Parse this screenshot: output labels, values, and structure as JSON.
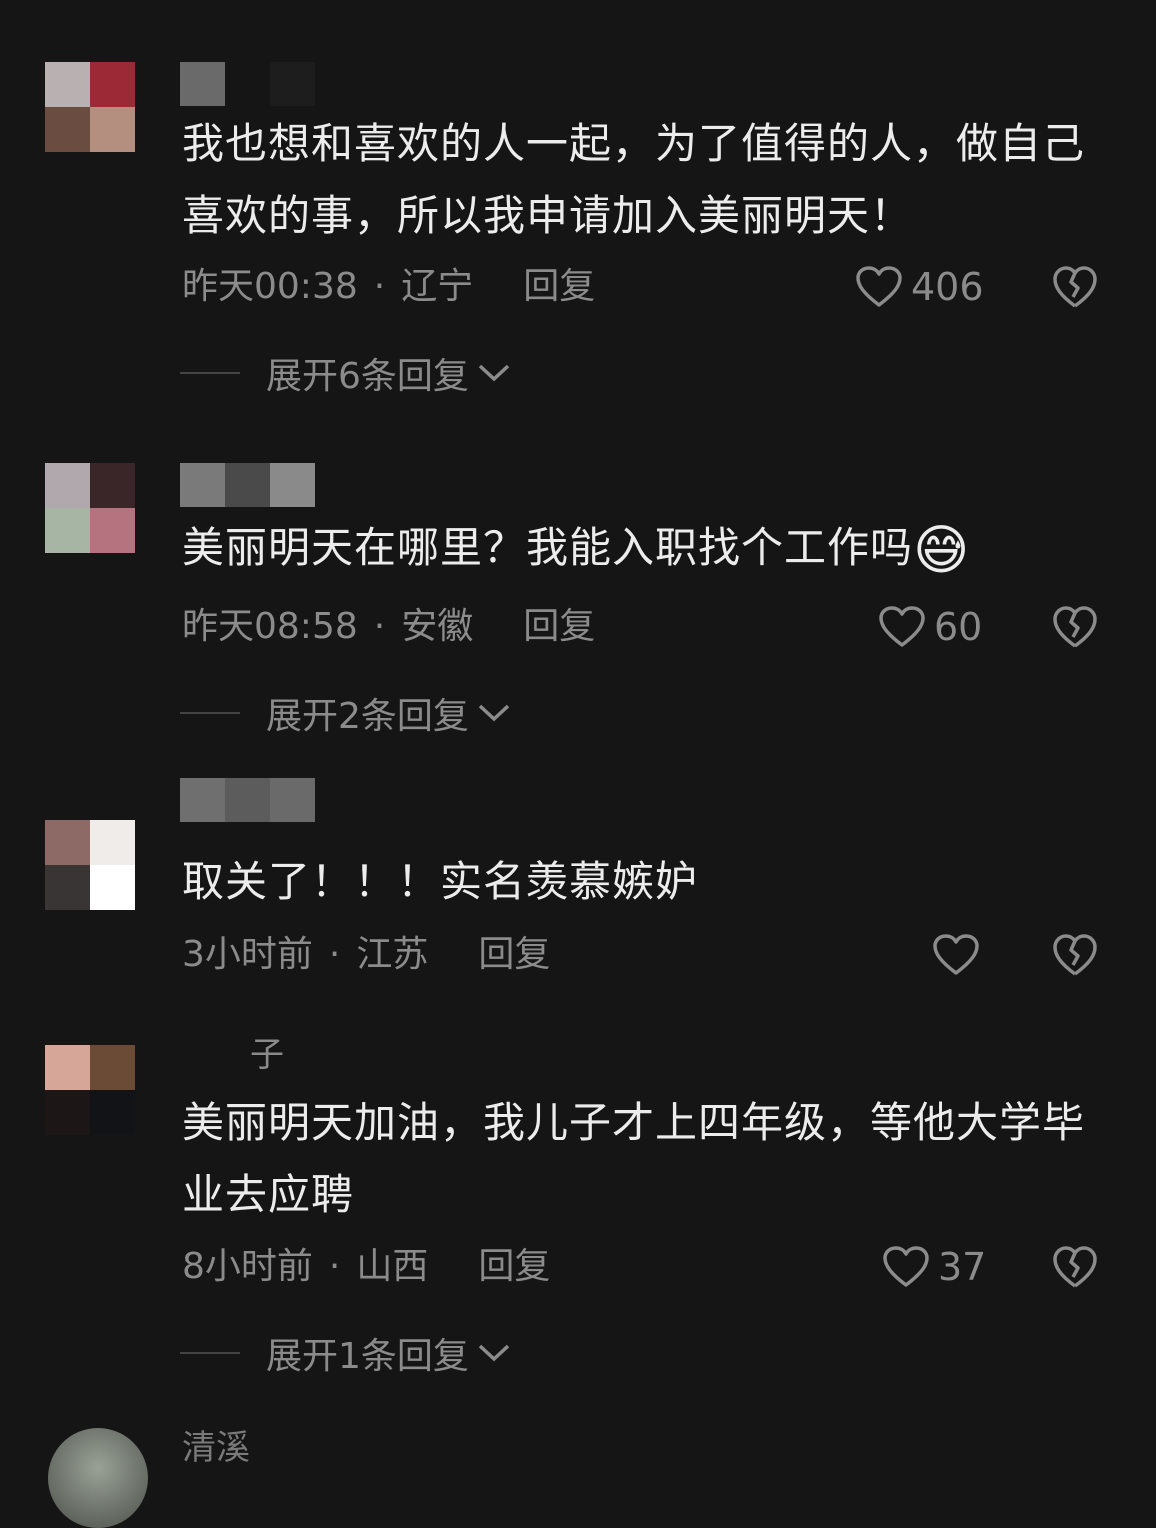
{
  "comments": [
    {
      "text": "我也想和喜欢的人一起，为了值得的人，做自己喜欢的事，所以我申请加入美丽明天！",
      "time": "昨天00:38",
      "location": "辽宁",
      "reply_label": "回复",
      "likes": "406",
      "expand_label": "展开6条回复"
    },
    {
      "text": "美丽明天在哪里？我能入职找个工作吗",
      "emoji": "😅",
      "time": "昨天08:58",
      "location": "安徽",
      "reply_label": "回复",
      "likes": "60",
      "expand_label": "展开2条回复"
    },
    {
      "text": "取关了！！！实名羡慕嫉妒",
      "time": "3小时前",
      "location": "江苏",
      "reply_label": "回复",
      "likes": ""
    },
    {
      "username": "子",
      "text": "美丽明天加油，我儿子才上四年级，等他大学毕业去应聘",
      "time": "8小时前",
      "location": "山西",
      "reply_label": "回复",
      "likes": "37",
      "expand_label": "展开1条回复"
    }
  ],
  "next_comment": {
    "username": "清溪"
  },
  "separator": "·",
  "icons": {
    "like": "heart-outline-icon",
    "dislike": "broken-heart-icon",
    "expand": "chevron-down-icon"
  },
  "colors": {
    "background": "#151515",
    "text": "#ececec",
    "meta": "#8b8b8b"
  }
}
